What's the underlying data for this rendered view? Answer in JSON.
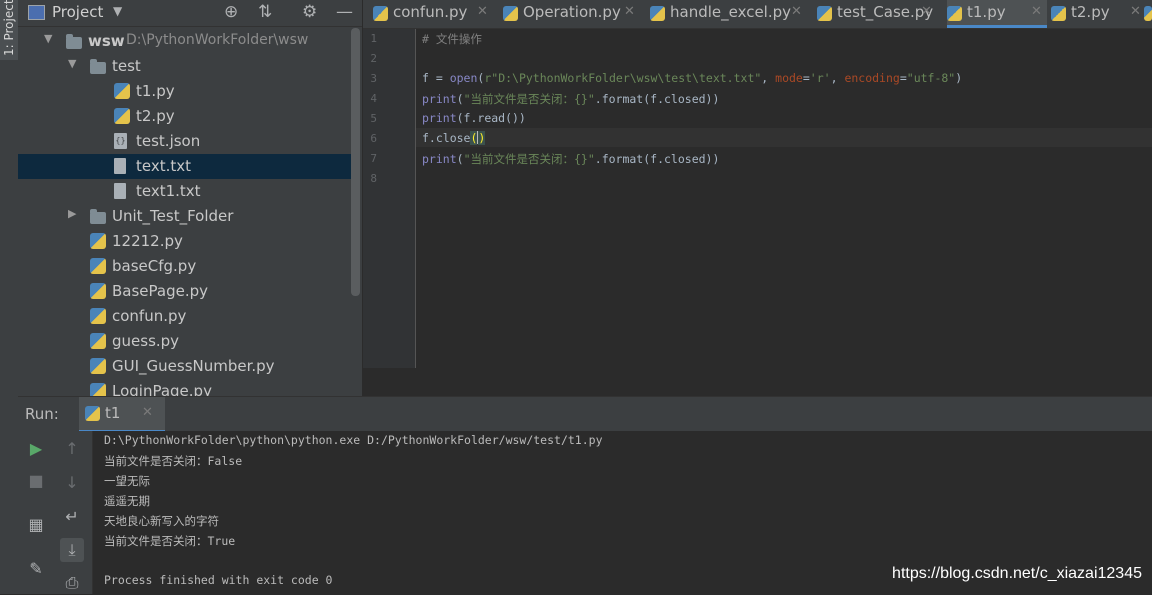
{
  "side_strip": {
    "label": "1: Project"
  },
  "project_panel": {
    "title": "Project",
    "tree": [
      {
        "label": "wsw",
        "path": "D:\\PythonWorkFolder\\wsw",
        "kind": "folder",
        "level": 0,
        "expanded": true
      },
      {
        "label": "test",
        "kind": "folder",
        "level": 1,
        "expanded": true
      },
      {
        "label": "t1.py",
        "kind": "py",
        "level": 2
      },
      {
        "label": "t2.py",
        "kind": "py",
        "level": 2
      },
      {
        "label": "test.json",
        "kind": "json",
        "level": 2
      },
      {
        "label": "text.txt",
        "kind": "txt",
        "level": 2,
        "selected": true
      },
      {
        "label": "text1.txt",
        "kind": "txt",
        "level": 2
      },
      {
        "label": "Unit_Test_Folder",
        "kind": "folder",
        "level": 1,
        "expanded": false
      },
      {
        "label": "12212.py",
        "kind": "py",
        "level": 1
      },
      {
        "label": "baseCfg.py",
        "kind": "py",
        "level": 1
      },
      {
        "label": "BasePage.py",
        "kind": "py",
        "level": 1
      },
      {
        "label": "confun.py",
        "kind": "py",
        "level": 1
      },
      {
        "label": "guess.py",
        "kind": "py",
        "level": 1
      },
      {
        "label": "GUI_GuessNumber.py",
        "kind": "py",
        "level": 1
      },
      {
        "label": "LoginPage.py",
        "kind": "py",
        "level": 1
      }
    ]
  },
  "tabs": [
    {
      "label": "confun.py",
      "active": false
    },
    {
      "label": "Operation.py",
      "active": false
    },
    {
      "label": "handle_excel.py",
      "active": false
    },
    {
      "label": "test_Case.py",
      "active": false
    },
    {
      "label": "t1.py",
      "active": true
    },
    {
      "label": "t2.py",
      "active": false
    }
  ],
  "editor": {
    "line_numbers": [
      "1",
      "2",
      "3",
      "4",
      "5",
      "6",
      "7",
      "8"
    ],
    "lines": [
      "# 文件操作",
      "",
      "f = open(r\"D:\\PythonWorkFolder\\wsw\\test\\text.txt\", mode='r', encoding=\"utf-8\")",
      "print(\"当前文件是否关闭：{}\".format(f.closed))",
      "print(f.read())",
      "f.close()",
      "print(\"当前文件是否关闭：{}\".format(f.closed))",
      ""
    ],
    "current_line": 6
  },
  "run_panel": {
    "label": "Run:",
    "tab_label": "t1",
    "output": [
      "D:\\PythonWorkFolder\\python\\python.exe D:/PythonWorkFolder/wsw/test/t1.py",
      "当前文件是否关闭：False",
      "一望无际",
      "遥遥无期",
      "天地良心新写入的字符",
      "当前文件是否关闭：True",
      "",
      "Process finished with exit code 0"
    ]
  },
  "watermark": "https://blog.csdn.net/c_xiazai12345",
  "colors": {
    "background": "#2b2b2b",
    "panel": "#3c3f41",
    "selection": "#0d293e",
    "accent": "#4a88c7"
  }
}
